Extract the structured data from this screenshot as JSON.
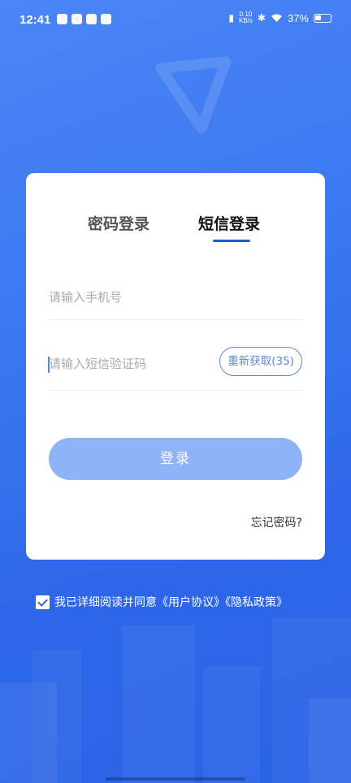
{
  "status_bar": {
    "time": "12:41",
    "net_speed_value": "0.10",
    "net_speed_unit": "KB/s",
    "battery": "37%"
  },
  "tabs": [
    {
      "label": "密码登录",
      "active": false
    },
    {
      "label": "短信登录",
      "active": true
    }
  ],
  "form": {
    "phone_placeholder": "请输入手机号",
    "code_placeholder": "请输入短信验证码",
    "resend_label": "重新获取(35)",
    "login_label": "登录",
    "forgot_label": "忘记密码?"
  },
  "agreement": {
    "checked": true,
    "text": "我已详细阅读并同意《用户协议》《隐私政策》"
  },
  "colors": {
    "accent": "#1f5fd6",
    "background": "#3a76f0",
    "login_button": "#8eb3f6"
  }
}
